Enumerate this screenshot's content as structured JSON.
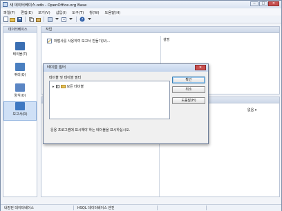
{
  "window": {
    "title": "새 데이터베이스.odb - OpenOffice.org Base",
    "min": "─",
    "max": "□",
    "close": "✕"
  },
  "menu": [
    "파일(F)",
    "편집(E)",
    "보기(V)",
    "삽입(I)",
    "도구(T)",
    "창(W)",
    "도움말(H)"
  ],
  "sidebar": {
    "title": "데이터베이스",
    "items": [
      {
        "label": "테이블(T)",
        "color": "#3b6fb3"
      },
      {
        "label": "쿼리(Q)",
        "color": "#4a7fc0"
      },
      {
        "label": "양식(O)",
        "color": "#5b86c4"
      },
      {
        "label": "보고서(R)",
        "color": "#3e78c2"
      }
    ]
  },
  "tasks": {
    "title": "작업",
    "item": "마법사를 사용하여 보고서 만들기(U)..."
  },
  "description": {
    "title": "설명"
  },
  "preview": {
    "dropdown": "없음"
  },
  "statusbar": {
    "left": "내장된 데이터베이스",
    "middle": "HSQL 데이터베이스 엔진"
  },
  "dialog": {
    "title": "테이블 필터",
    "close": "✕",
    "group_label": "테이블 및 테이블 필터",
    "tree_item": "모든 테이블",
    "checked": "✓",
    "hint": "응용 프로그램에 표시해야 하는 테이블을 표시하십시오.",
    "ok": "확인",
    "cancel": "취소",
    "help": "도움말(H)"
  },
  "colors": {
    "accent": "#3c7fb1",
    "close": "#c75050"
  }
}
